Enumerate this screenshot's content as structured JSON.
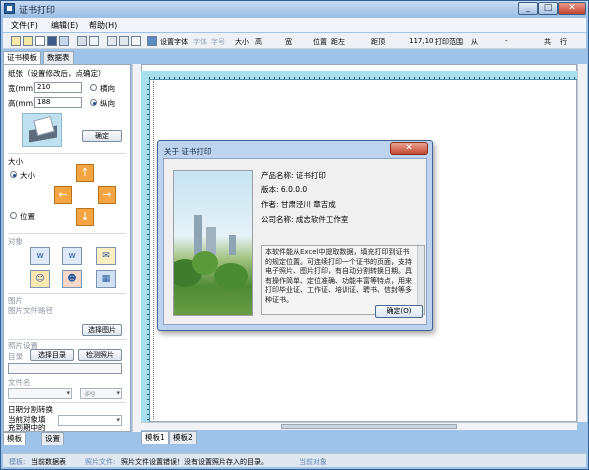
{
  "window": {
    "title": "证书打印",
    "min": "_",
    "max": "□",
    "close": "✕"
  },
  "menu": [
    "文件(F)",
    "编辑(E)",
    "帮助(H)"
  ],
  "toolbar": {
    "set_font": "设置字体",
    "font_body": "字体",
    "font_size": "字号",
    "size_label": "大小",
    "height_label": "高",
    "width_label": "宽",
    "position_label": "位置",
    "distance_left": "距左",
    "distance_top": "距顶",
    "coords": "117,10",
    "print_range": "打印范围",
    "from": "从",
    "dash": "-",
    "total": "共",
    "row": "行"
  },
  "top_tabs": [
    "证书模板",
    "数据表"
  ],
  "left": {
    "paper_heading": "纸张（设置修改后，点确定）",
    "width_label": "宽(mm)",
    "width_value": "210",
    "height_label": "高(mm)",
    "height_value": "188",
    "landscape": "横向",
    "portrait": "纵向",
    "confirm": "确定",
    "size_heading": "大小",
    "size_radio": "大小",
    "position_radio": "位置",
    "object_heading": "对象",
    "picture_heading": "图片",
    "picture_path": "图片文件路径",
    "choose_picture": "选择图片",
    "photo_heading": "照片设置",
    "directory": "目录",
    "choose_directory": "选择目录",
    "detect_photo": "检测照片",
    "filename_label": "文件名",
    "jpg": ".jpg",
    "date_split": "日期分割转换",
    "current_object_fill": "当前对象填",
    "fill_into": "充到期中的"
  },
  "bottom_left_tabs": [
    "模板",
    "设置"
  ],
  "canvas_tabs": [
    "模板1",
    "模板2"
  ],
  "status": {
    "template_label": "模板:",
    "template_value": "当前数据表",
    "photo_label": "照片文件:",
    "photo_value": "照片文件设置错误！没有设置照片存入的目录。",
    "current_object": "当前对象"
  },
  "about": {
    "title": "关于 证书打印",
    "close": "✕",
    "product_name": "产品名称: 证书打印",
    "version": "版本: 6.0.0.0",
    "author": "作者: 甘肃泾川 章吉成",
    "company": "公司名称: 成志软件工作室",
    "description": "本软件能从Excel中提取数据，填充打印到证书的规定位置。可连续打印一个证书的页面，支持电子照片、图片打印，有自动分割转换日期。具有操作简单、定位准确、功能丰富等特点，用来打印毕业证、工作证、培训证、聘书、信封等多种证书。",
    "ok": "确定(O)"
  }
}
